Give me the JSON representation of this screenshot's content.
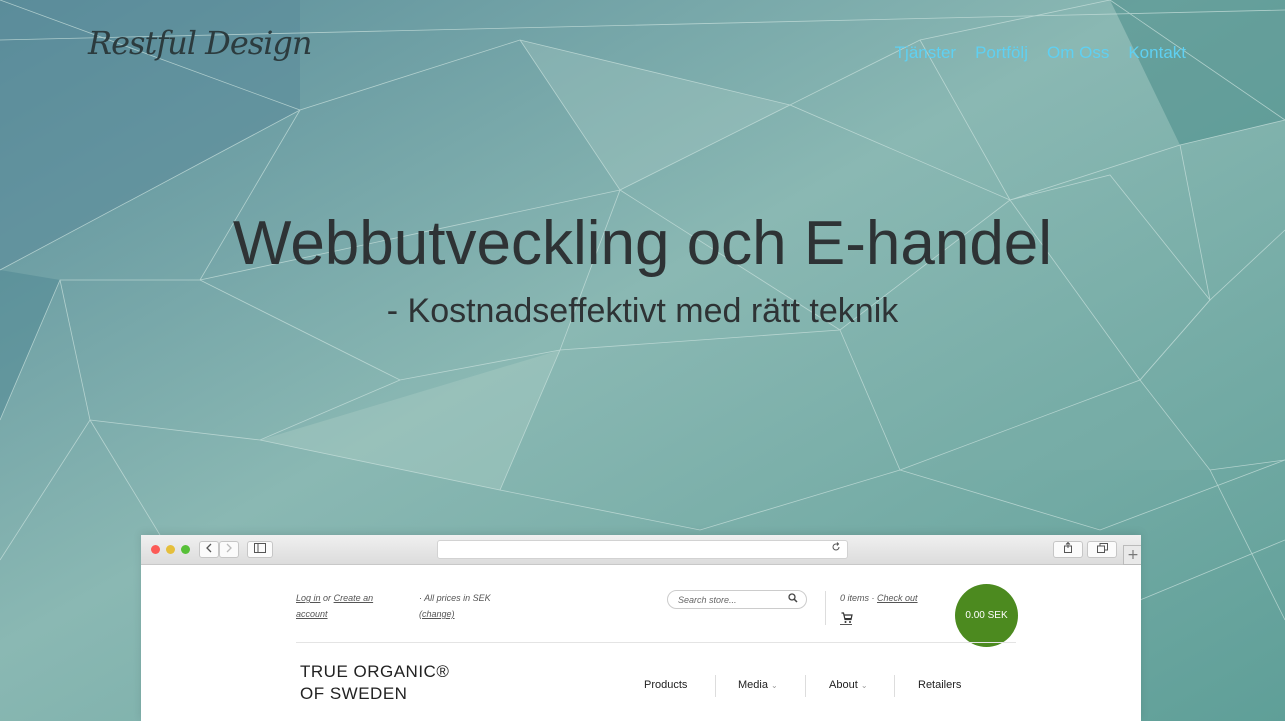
{
  "site": {
    "logo": "Restful Design",
    "nav": [
      "Tjänster",
      "Portfölj",
      "Om Oss",
      "Kontakt"
    ]
  },
  "hero": {
    "title": "Webbutveckling och E-handel",
    "subtitle": "- Kostnadseffektivt med rätt teknik"
  },
  "colors": {
    "nav_link": "#5fd0f2",
    "cart_button": "#4c8a1f"
  },
  "browser": {
    "back_icon": "chevron-left-icon",
    "forward_icon": "chevron-right-icon",
    "sidebar_icon": "sidebar-icon",
    "reload_icon": "reload-icon",
    "share_icon": "share-icon",
    "tabs_icon": "tabs-icon",
    "newtab_label": "+"
  },
  "store": {
    "login": "Log in",
    "or": "or",
    "create_line1": "Create an",
    "create_line2": "account",
    "prices": "· All prices in SEK",
    "change": "(change)",
    "search_placeholder": "Search store...",
    "items": "0 items ·",
    "checkout": "Check out",
    "cart_total": "0.00 SEK",
    "brand_line1": "TRUE ORGANIC®",
    "brand_line2": "OF SWEDEN",
    "menu": [
      {
        "label": "Products",
        "caret": ""
      },
      {
        "label": "Media",
        "caret": "⌄"
      },
      {
        "label": "About",
        "caret": "⌄"
      },
      {
        "label": "Retailers",
        "caret": ""
      }
    ]
  }
}
